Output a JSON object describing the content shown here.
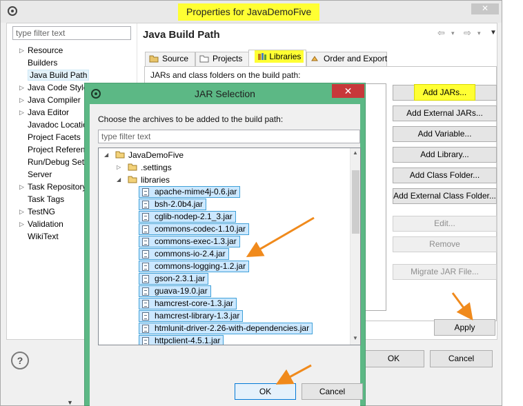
{
  "properties_window": {
    "title": "Properties for JavaDemoFive",
    "close_glyph": "✕",
    "filter_placeholder": "type filter text",
    "nav_items": [
      {
        "label": "Resource",
        "expandable": true
      },
      {
        "label": "Builders",
        "expandable": false
      },
      {
        "label": "Java Build Path",
        "expandable": false,
        "selected": true
      },
      {
        "label": "Java Code Style",
        "expandable": true
      },
      {
        "label": "Java Compiler",
        "expandable": true
      },
      {
        "label": "Java Editor",
        "expandable": true
      },
      {
        "label": "Javadoc Location",
        "expandable": false
      },
      {
        "label": "Project Facets",
        "expandable": false
      },
      {
        "label": "Project References",
        "expandable": false
      },
      {
        "label": "Run/Debug Settings",
        "expandable": false
      },
      {
        "label": "Server",
        "expandable": false
      },
      {
        "label": "Task Repository",
        "expandable": true
      },
      {
        "label": "Task Tags",
        "expandable": false
      },
      {
        "label": "TestNG",
        "expandable": true
      },
      {
        "label": "Validation",
        "expandable": true
      },
      {
        "label": "WikiText",
        "expandable": false
      }
    ],
    "page_title": "Java Build Path",
    "history_nav": {
      "back": "⇦",
      "back_menu": "▾",
      "forward": "⇨",
      "forward_menu": "▾",
      "view_menu": "▼"
    },
    "tabs": [
      {
        "label": "Source",
        "icon": "source-folder-icon"
      },
      {
        "label": "Projects",
        "icon": "projects-icon"
      },
      {
        "label": "Libraries",
        "icon": "libraries-icon",
        "active": true
      },
      {
        "label": "Order and Export",
        "icon": "order-export-icon"
      }
    ],
    "panel_caption": "JARs and class folders on the build path:",
    "buttons": {
      "add_jars": "Add JARs...",
      "add_external_jars": "Add External JARs...",
      "add_variable": "Add Variable...",
      "add_library": "Add Library...",
      "add_class_folder": "Add Class Folder...",
      "add_external_class_folder": "Add External Class Folder...",
      "edit": "Edit...",
      "remove": "Remove",
      "migrate": "Migrate JAR File...",
      "apply": "Apply",
      "ok": "OK",
      "cancel": "Cancel",
      "help": "?"
    }
  },
  "jar_dialog": {
    "title": "JAR Selection",
    "close_glyph": "✕",
    "caption": "Choose the archives to be added to the build path:",
    "filter_placeholder": "type filter text",
    "project": "JavaDemoFive",
    "folders": [
      ".settings",
      "libraries"
    ],
    "jars": [
      "apache-mime4j-0.6.jar",
      "bsh-2.0b4.jar",
      "cglib-nodep-2.1_3.jar",
      "commons-codec-1.10.jar",
      "commons-exec-1.3.jar",
      "commons-io-2.4.jar",
      "commons-logging-1.2.jar",
      "gson-2.3.1.jar",
      "guava-19.0.jar",
      "hamcrest-core-1.3.jar",
      "hamcrest-library-1.3.jar",
      "htmlunit-driver-2.26-with-dependencies.jar",
      "httpclient-4.5.1.jar"
    ],
    "ok": "OK",
    "cancel": "Cancel"
  },
  "colors": {
    "highlight": "#ffff33",
    "dialog_frame": "#5cb885",
    "selection_fill": "#cce8ff",
    "selection_border": "#3fa0d8",
    "annotation_arrow": "#f08a1c"
  }
}
